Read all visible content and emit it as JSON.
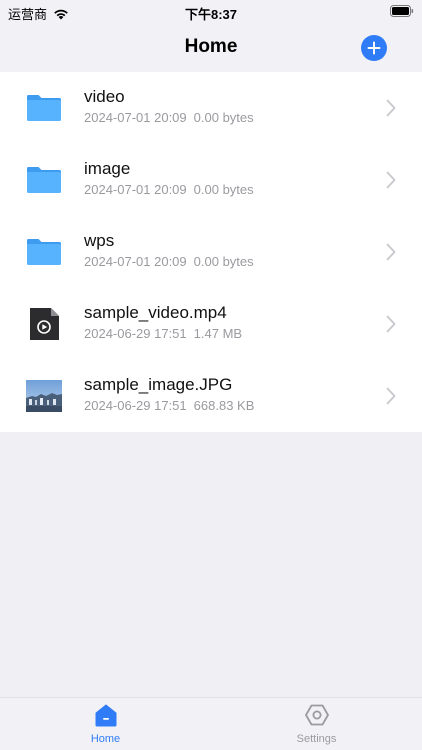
{
  "status_bar": {
    "carrier": "运营商",
    "time": "下午8:37",
    "wifi_icon": "wifi-icon",
    "battery_icon": "battery-icon"
  },
  "nav": {
    "title": "Home",
    "add_icon": "plus-circle-icon",
    "accent_color": "#2f7cf6"
  },
  "files": [
    {
      "name": "video",
      "date": "2024-07-01 20:09",
      "size": "0.00 bytes",
      "icon": "folder-icon"
    },
    {
      "name": "image",
      "date": "2024-07-01 20:09",
      "size": "0.00 bytes",
      "icon": "folder-icon"
    },
    {
      "name": "wps",
      "date": "2024-07-01 20:09",
      "size": "0.00 bytes",
      "icon": "folder-icon"
    },
    {
      "name": "sample_video.mp4",
      "date": "2024-06-29 17:51",
      "size": "1.47 MB",
      "icon": "video-file-icon"
    },
    {
      "name": "sample_image.JPG",
      "date": "2024-06-29 17:51",
      "size": "668.83 KB",
      "icon": "image-thumbnail"
    }
  ],
  "tabs": {
    "home": {
      "label": "Home",
      "icon": "home-icon",
      "active": true
    },
    "settings": {
      "label": "Settings",
      "icon": "hexagon-gear-icon",
      "active": false
    }
  }
}
